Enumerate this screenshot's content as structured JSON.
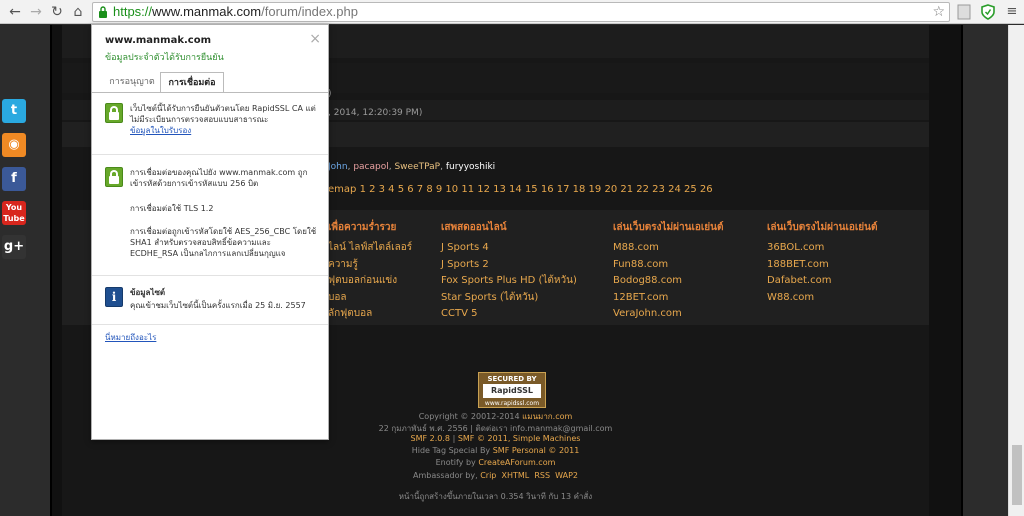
{
  "browser": {
    "url_scheme": "https://",
    "url_host": "www.manmak.com",
    "url_path": "/forum/index.php",
    "back_glyph": "←",
    "forward_glyph": "→",
    "reload_glyph": "↻",
    "home_glyph": "⌂",
    "star_glyph": "☆"
  },
  "popup": {
    "host": "www.manmak.com",
    "verified": "ข้อมูลประจำตัวได้รับการยืนยัน",
    "close_glyph": "×",
    "tabs": [
      "การอนุญาต",
      "การเชื่อมต่อ"
    ],
    "identity_text": "เว็บไซต์นี้ได้รับการยืนยันตัวตนโดย RapidSSL CA แต่ไม่มีระเบียนการตรวจสอบแบบสาธารณะ",
    "cert_link": "ข้อมูลในใบรับรอง",
    "conn_text_1": "การเชื่อมต่อของคุณไปยัง www.manmak.com ถูกเข้ารหัสด้วยการเข้ารหัสแบบ 256 บิต",
    "conn_text_2": "การเชื่อมต่อใช้ TLS 1.2",
    "conn_text_3": "การเชื่อมต่อถูกเข้ารหัสโดยใช้ AES_256_CBC โดยใช้ SHA1 สำหรับตรวจสอบสิทธิ์ข้อความและ ECDHE_RSA เป็นกลไกการแลกเปลี่ยนกุญแจ",
    "info_glyph": "i",
    "site_info_title": "ข้อมูลไซต์",
    "site_info_text": "คุณเข้าชมเว็บไซต์นี้เป็นครั้งแรกเมื่อ 25 มิ.ย. 2557",
    "help_link": "นี่หมายถึงอะไร"
  },
  "page": {
    "fragment_paren": ")",
    "date_fragment": ", 2014, 12:20:39 PM)",
    "members": [
      "John",
      "pacapol",
      "SweeTPaP",
      "furyyoshiki"
    ],
    "member_sep": ", ",
    "sitemap_label": "emap",
    "sitemap_pages": "1 2 3 4 5 6 7 8 9 10 11 12 13 14 15 16 17 18 19 20 21 22 23 24 25 26",
    "columns": [
      {
        "title": "เพื่อความร่ำรวย",
        "links": [
          "ไลน์ ไลฟ์สไตล์เลอร์",
          "ความรู้",
          "ฟุตบอลก่อนแข่ง",
          "บอล",
          "ลักฟุตบอล"
        ]
      },
      {
        "title": "เสพสดออนไลน์",
        "links": [
          "J Sports 4",
          "J Sports 2",
          "Fox Sports Plus HD (ไต้หวัน)",
          "Star Sports (ไต้หวัน)",
          "CCTV 5"
        ]
      },
      {
        "title": "เล่นเว็บตรงไม่ผ่านเอเย่นต์",
        "links": [
          "M88.com",
          "Fun88.com",
          "Bodog88.com",
          "12BET.com",
          "VeraJohn.com"
        ]
      },
      {
        "title": "เล่นเว็บตรงไม่ผ่านเอเย่นต์",
        "links": [
          "36BOL.com",
          "188BET.com",
          "Dafabet.com",
          "W88.com"
        ]
      }
    ],
    "badge": {
      "line1": "SECURED BY",
      "line2": "RapidSSL",
      "line3": "www.rapidssl.com"
    },
    "footer": {
      "copyright": "Copyright © 20012-2014",
      "copyright_site": "แมนมาก.com",
      "contact": "22 กุมภาพันธ์ พ.ศ. 2556 | ติดต่อเรา info.manmak@gmail.com",
      "smf_a": "SMF 2.0.8",
      "smf_sep": "|",
      "smf_b": "SMF © 2011, Simple Machines",
      "hide_tag": "Hide Tag Special By",
      "hide_tag_by": "SMF Personal © 2011",
      "enotify": "Enotify by",
      "enotify_by": "CreateAForum.com",
      "ambassador": "Ambassador by,",
      "amb_links": [
        "Crip",
        "XHTML",
        "RSS",
        "WAP2"
      ],
      "page_time": "หน้านี้ถูกสร้างขึ้นภายในเวลา 0.354 วินาที กับ 13 คำสั่ง"
    }
  },
  "social": {
    "twitter": "t",
    "rss": "◉",
    "facebook": "f",
    "youtube_top": "You",
    "youtube_bottom": "Tube",
    "gplus": "g+"
  }
}
